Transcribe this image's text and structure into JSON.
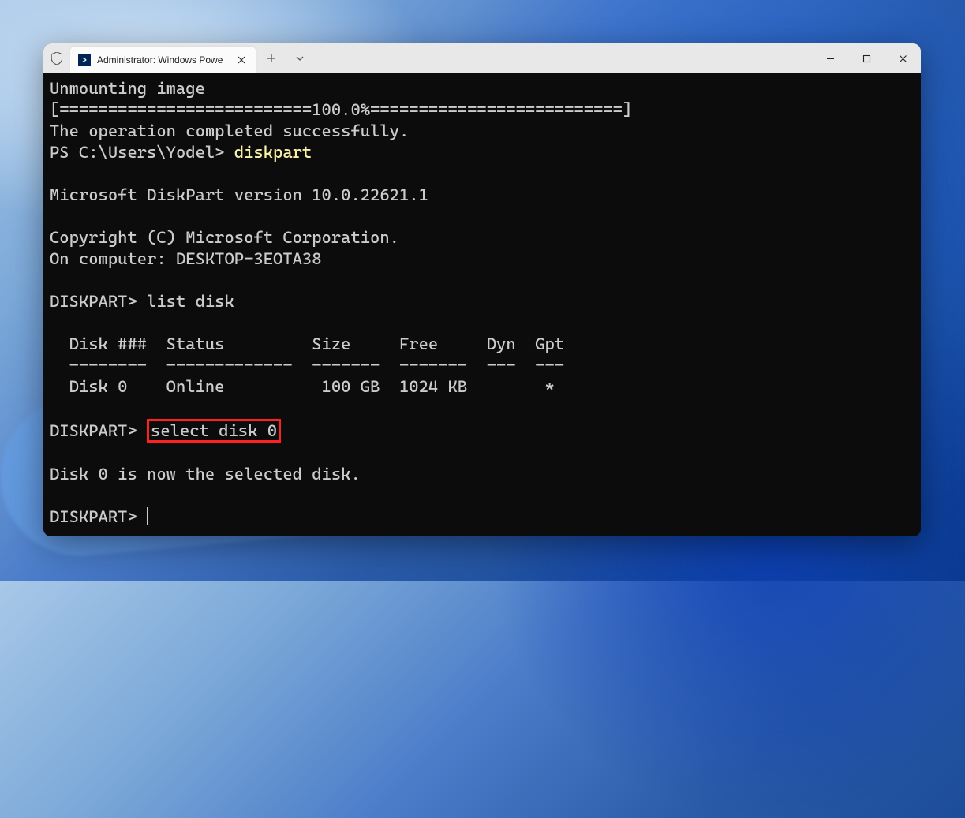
{
  "window": {
    "tab_title": "Administrator: Windows Powe"
  },
  "terminal": {
    "line1": "Unmounting image",
    "line2": "[==========================100.0%==========================]",
    "line3": "The operation completed successfully.",
    "ps_prompt": "PS C:\\Users\\Yodel> ",
    "ps_cmd": "diskpart",
    "blank1": "",
    "dp_version": "Microsoft DiskPart version 10.0.22621.1",
    "blank2": "",
    "copyright": "Copyright (C) Microsoft Corporation.",
    "computer": "On computer: DESKTOP-3EOTA38",
    "blank3": "",
    "dp_prompt1": "DISKPART> ",
    "dp_cmd1": "list disk",
    "blank4": "",
    "header": "  Disk ###  Status         Size     Free     Dyn  Gpt",
    "divider": "  --------  -------------  -------  -------  ---  ---",
    "row": "  Disk 0    Online          100 GB  1024 KB        *",
    "blank5": "",
    "dp_prompt2": "DISKPART> ",
    "dp_cmd2": "select disk 0",
    "blank6": "",
    "selected": "Disk 0 is now the selected disk.",
    "blank7": "",
    "dp_prompt3": "DISKPART> "
  }
}
